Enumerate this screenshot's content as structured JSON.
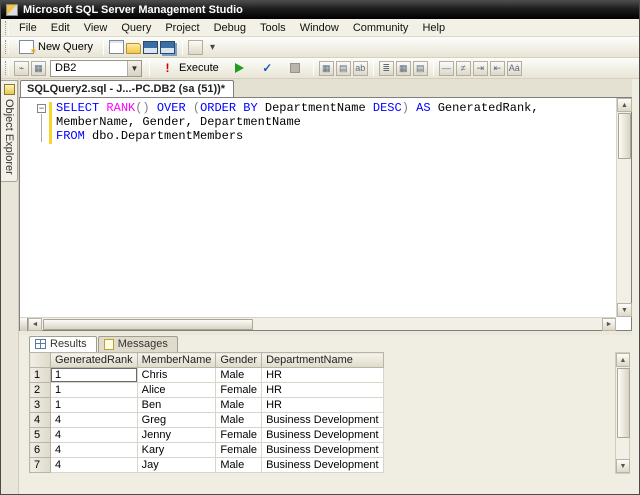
{
  "window": {
    "title": "Microsoft SQL Server Management Studio"
  },
  "menu": {
    "items": [
      "File",
      "Edit",
      "View",
      "Query",
      "Project",
      "Debug",
      "Tools",
      "Window",
      "Community",
      "Help"
    ]
  },
  "colors": {
    "keyword": "#0000ff",
    "function": "#ff00ff",
    "operator": "#808080",
    "change_bar": "#f5d52e"
  },
  "toolbar_standard": {
    "new_query_label": "New Query",
    "icons": [
      {
        "name": "new-document-icon",
        "cls": "ic-doc"
      },
      {
        "name": "open-file-icon",
        "cls": "ic-folder"
      },
      {
        "name": "save-icon",
        "cls": "ic-floppy"
      },
      {
        "name": "save-all-icon",
        "cls": "ic-floppy-multi"
      },
      {
        "name": "separator",
        "cls": "sep"
      },
      {
        "name": "source-control-icon",
        "cls": "ic-generic"
      },
      {
        "name": "toolbar-options-dropdown-icon",
        "cls": "ic-dd",
        "glyph": "▾"
      }
    ]
  },
  "toolbar_sql": {
    "database_value": "DB2",
    "execute_label": "Execute",
    "icons_pre": [
      {
        "name": "change-connection-icon",
        "cls": "ic-generic",
        "glyph": "⌁"
      },
      {
        "name": "available-databases-icon",
        "cls": "ic-generic",
        "glyph": "▦"
      }
    ],
    "icons_post": [
      {
        "name": "display-estimated-plan-icon",
        "cls": "ic-generic",
        "glyph": "▦"
      },
      {
        "name": "query-options-icon",
        "cls": "ic-generic",
        "glyph": "▤"
      },
      {
        "name": "intellisense-enabled-icon",
        "cls": "ic-generic",
        "glyph": "ab"
      },
      {
        "name": "separator",
        "cls": "sep"
      },
      {
        "name": "results-to-text-icon",
        "cls": "ic-generic",
        "glyph": "≣"
      },
      {
        "name": "results-to-grid-icon",
        "cls": "ic-generic",
        "glyph": "▦"
      },
      {
        "name": "results-to-file-icon",
        "cls": "ic-generic",
        "glyph": "▤"
      },
      {
        "name": "separator",
        "cls": "sep"
      },
      {
        "name": "comment-icon",
        "cls": "ic-generic",
        "glyph": "—"
      },
      {
        "name": "uncomment-icon",
        "cls": "ic-generic",
        "glyph": "≠"
      },
      {
        "name": "indent-icon",
        "cls": "ic-generic",
        "glyph": "⇥"
      },
      {
        "name": "outdent-icon",
        "cls": "ic-generic",
        "glyph": "⇤"
      },
      {
        "name": "template-parameters-icon",
        "cls": "ic-generic",
        "glyph": "Aȧ"
      }
    ]
  },
  "left_dock": {
    "object_explorer_label": "Object Explorer"
  },
  "editor": {
    "tab_title": "SQLQuery2.sql - J...-PC.DB2 (sa (51))*",
    "fold_glyph": "−",
    "lines": [
      {
        "tokens": [
          {
            "t": "k",
            "s": "SELECT "
          },
          {
            "t": "f",
            "s": "RANK"
          },
          {
            "t": "g",
            "s": "() "
          },
          {
            "t": "k",
            "s": "OVER "
          },
          {
            "t": "g",
            "s": "("
          },
          {
            "t": "k",
            "s": "ORDER BY "
          },
          {
            "t": "i",
            "s": "DepartmentName "
          },
          {
            "t": "k",
            "s": "DESC"
          },
          {
            "t": "g",
            "s": ") "
          },
          {
            "t": "k",
            "s": "AS "
          },
          {
            "t": "i",
            "s": "GeneratedRank,"
          }
        ]
      },
      {
        "tokens": [
          {
            "t": "i",
            "s": "MemberName, Gender, DepartmentName"
          }
        ]
      },
      {
        "tokens": [
          {
            "t": "k",
            "s": "FROM "
          },
          {
            "t": "i",
            "s": "dbo.DepartmentMembers"
          }
        ]
      }
    ]
  },
  "results": {
    "tabs": [
      "Results",
      "Messages"
    ],
    "columns": [
      "GeneratedRank",
      "MemberName",
      "Gender",
      "DepartmentName"
    ],
    "rows": [
      {
        "num": "1",
        "cells": [
          "1",
          "Chris",
          "Male",
          "HR"
        ]
      },
      {
        "num": "2",
        "cells": [
          "1",
          "Alice",
          "Female",
          "HR"
        ]
      },
      {
        "num": "3",
        "cells": [
          "1",
          "Ben",
          "Male",
          "HR"
        ]
      },
      {
        "num": "4",
        "cells": [
          "4",
          "Greg",
          "Male",
          "Business Development"
        ]
      },
      {
        "num": "5",
        "cells": [
          "4",
          "Jenny",
          "Female",
          "Business Development"
        ]
      },
      {
        "num": "6",
        "cells": [
          "4",
          "Kary",
          "Female",
          "Business Development"
        ]
      },
      {
        "num": "7",
        "cells": [
          "4",
          "Jay",
          "Male",
          "Business Development"
        ]
      }
    ],
    "selected": {
      "row_index": 0,
      "col_index": 0
    }
  }
}
